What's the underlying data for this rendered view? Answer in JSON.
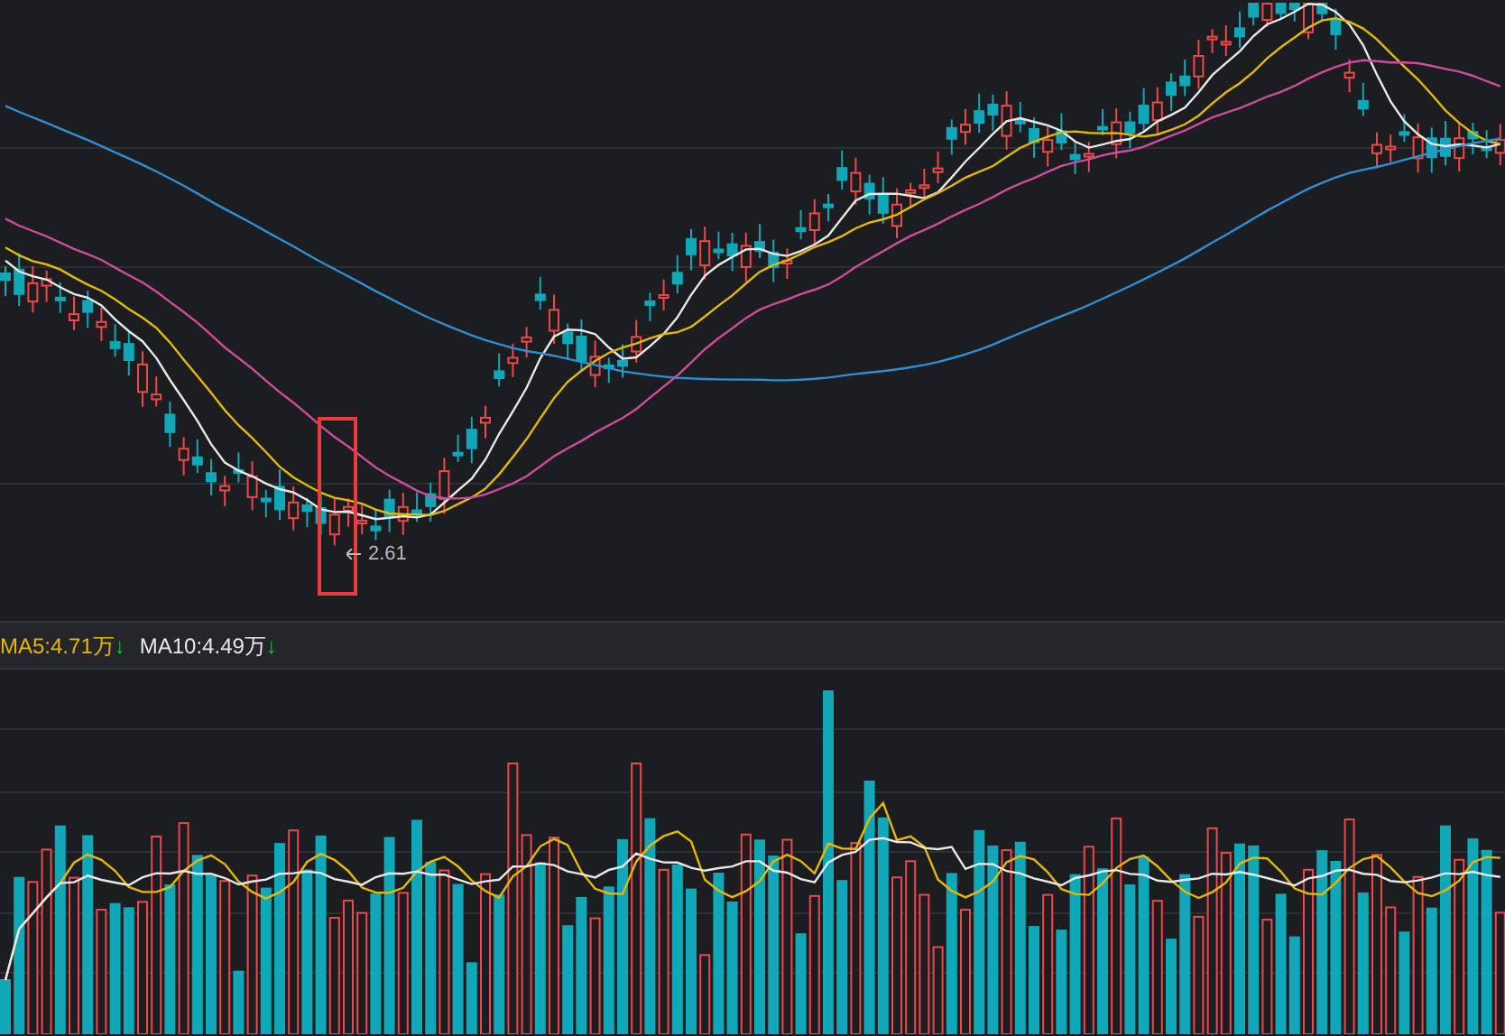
{
  "price_chart": {
    "low_label": "2.61",
    "highlight_box": true
  },
  "volume_panel": {
    "indicators": [
      {
        "text": "MA5:4.71万",
        "color": "#e6b800",
        "trend": "↓"
      },
      {
        "text": "MA10:4.49万",
        "color": "#e8e8e8",
        "trend": "↓"
      }
    ]
  }
}
